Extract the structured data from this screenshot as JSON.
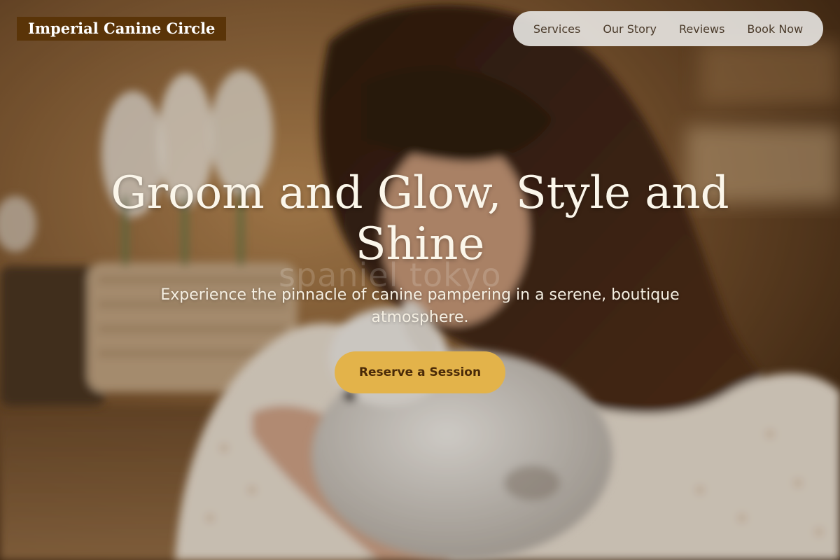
{
  "brand": {
    "name": "Imperial Canine Circle"
  },
  "nav": {
    "items": [
      {
        "label": "Services"
      },
      {
        "label": "Our Story"
      },
      {
        "label": "Reviews"
      },
      {
        "label": "Book Now"
      }
    ]
  },
  "hero": {
    "headline": "Groom and Glow, Style and Shine",
    "subheadline": "Experience the pinnacle of canine pampering in a serene, boutique atmosphere.",
    "cta_label": "Reserve a Session",
    "photo_watermark": "spaniel tokyo"
  },
  "colors": {
    "brand_badge": "#5a3408",
    "cta": "#e3b34a",
    "cta_text": "#4a2a08",
    "nav_bg": "#e8e6e2"
  }
}
